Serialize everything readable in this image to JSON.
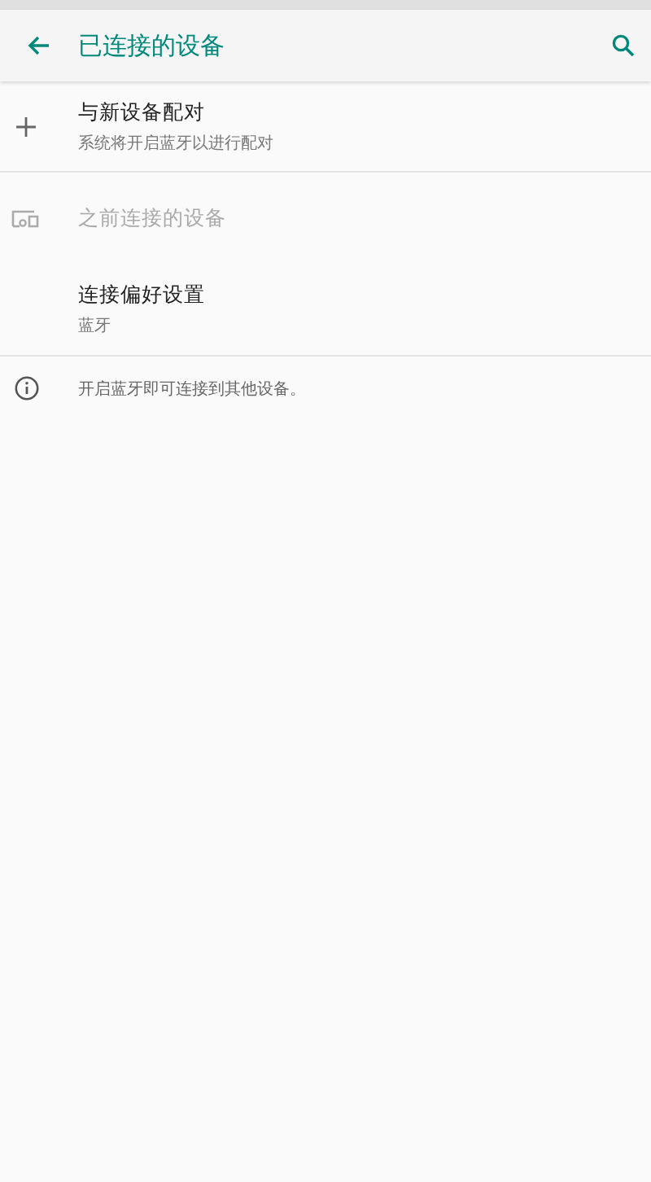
{
  "toolbar": {
    "title": "已连接的设备"
  },
  "items": [
    {
      "title": "与新设备配对",
      "subtitle": "系统将开启蓝牙以进行配对",
      "disabled": false
    },
    {
      "title": "之前连接的设备",
      "disabled": true
    },
    {
      "title": "连接偏好设置",
      "subtitle": "蓝牙",
      "disabled": false
    }
  ],
  "footer": {
    "text": "开启蓝牙即可连接到其他设备。"
  }
}
